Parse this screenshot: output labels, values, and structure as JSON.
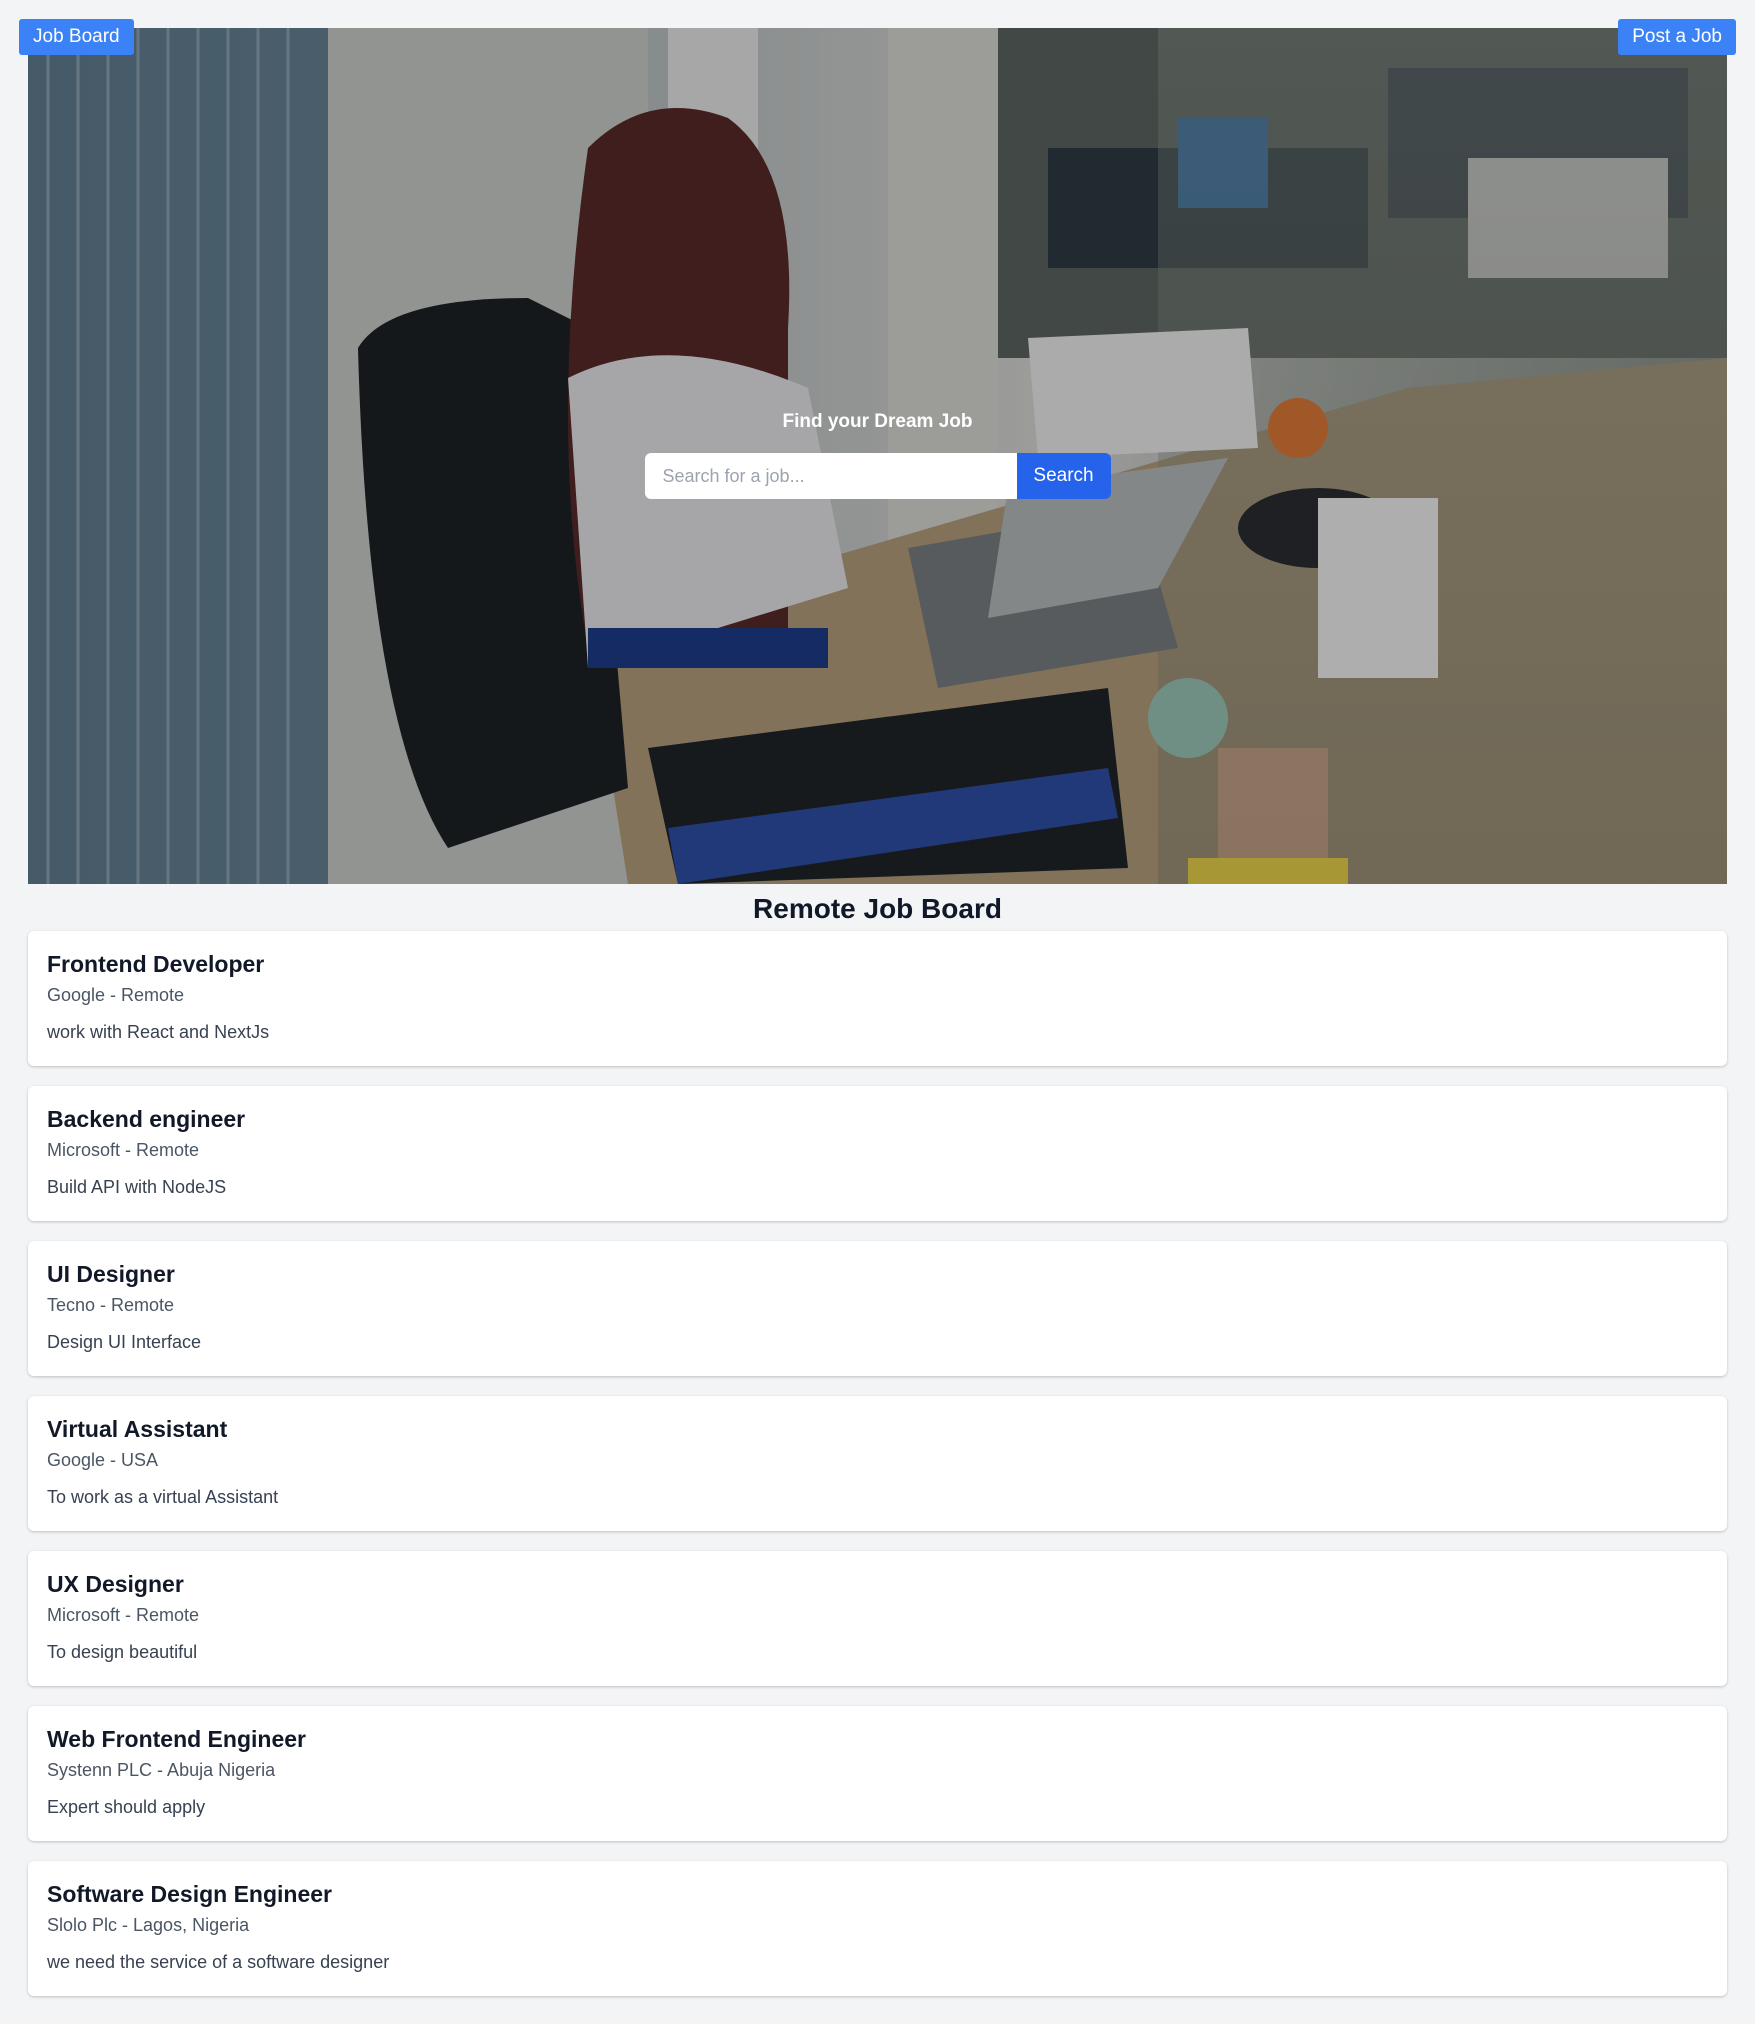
{
  "nav": {
    "brand_label": "Job Board",
    "post_job_label": "Post a Job"
  },
  "hero": {
    "heading": "Find your Dream Job",
    "search_placeholder": "Search for a job...",
    "search_value": "",
    "search_button_label": "Search",
    "background_image": "office-workspace-photo"
  },
  "board": {
    "title": "Remote Job Board"
  },
  "jobs": [
    {
      "title": "Frontend Developer",
      "meta": "Google - Remote",
      "description": "work with React and NextJs"
    },
    {
      "title": "Backend engineer",
      "meta": "Microsoft - Remote",
      "description": "Build API with NodeJS"
    },
    {
      "title": "UI Designer",
      "meta": "Tecno - Remote",
      "description": "Design UI Interface"
    },
    {
      "title": "Virtual Assistant",
      "meta": "Google - USA",
      "description": "To work as a virtual Assistant"
    },
    {
      "title": "UX Designer",
      "meta": "Microsoft - Remote",
      "description": "To design beautiful"
    },
    {
      "title": "Web Frontend Engineer",
      "meta": "Systenn PLC - Abuja Nigeria",
      "description": "Expert should apply"
    },
    {
      "title": "Software Design Engineer",
      "meta": "Slolo Plc - Lagos, Nigeria",
      "description": "we need the service of a software designer"
    }
  ],
  "colors": {
    "accent": "#3b82f6",
    "search_button": "#2563eb",
    "page_background": "#f3f4f6",
    "card_background": "#ffffff"
  }
}
